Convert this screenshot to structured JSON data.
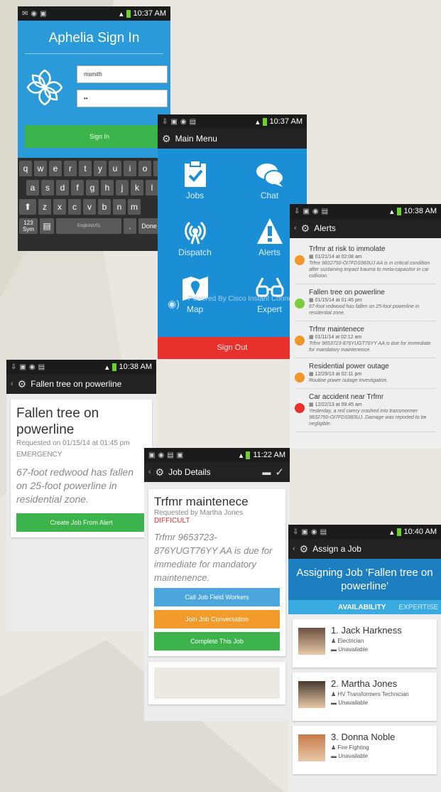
{
  "signin": {
    "time": "10:37 AM",
    "title": "Aphelia Sign In",
    "username": "msmith",
    "password": "••",
    "button": "Sign In",
    "keys_row1": [
      "q",
      "w",
      "e",
      "r",
      "t",
      "y",
      "u",
      "i",
      "o",
      "p"
    ],
    "keys_row2": [
      "a",
      "s",
      "d",
      "f",
      "g",
      "h",
      "j",
      "k",
      "l"
    ],
    "keys_row3": [
      "z",
      "x",
      "c",
      "v",
      "b",
      "n",
      "m"
    ],
    "sym": "123\nSym",
    "space": "English(US)",
    "done": "Done"
  },
  "menu": {
    "time": "10:37 AM",
    "title": "Main Menu",
    "items": [
      {
        "label": "Jobs",
        "icon": "clipboard-check-icon"
      },
      {
        "label": "Chat",
        "icon": "chat-bubbles-icon"
      },
      {
        "label": "Dispatch",
        "icon": "broadcast-icon"
      },
      {
        "label": "Alerts",
        "icon": "warning-icon"
      },
      {
        "label": "Map",
        "icon": "map-pin-icon"
      },
      {
        "label": "Expert",
        "icon": "glasses-icon"
      }
    ],
    "powered": "Powered By Cisco Instant Connect",
    "signout": "Sign Out"
  },
  "alerts": {
    "time": "10:38 AM",
    "title": "Alerts",
    "items": [
      {
        "title": "Trfmr at risk to immolate",
        "date": "01/21/14 at 02:08 am",
        "desc": "Trfmr 9832750-OI7FDS983UJ AA is in critical condition after sustaining impact trauma to meta-capacitor in car collision.",
        "color": "#f0962a"
      },
      {
        "title": "Fallen tree on powerline",
        "date": "01/15/14 at 01:45 pm",
        "desc": "67-foot redwood has fallen on 25-foot powerline in residential zone.",
        "color": "#7ccb3c"
      },
      {
        "title": "Trfmr maintenece",
        "date": "01/11/14 at 02:12 am",
        "desc": "Trfmr 9653723-876YUGT76YY AA is due for immediate for mandatory maintenence.",
        "color": "#f0962a"
      },
      {
        "title": "Residential power outage",
        "date": "12/29/13 at 02:11 pm",
        "desc": "Routine power outage investigation.",
        "color": "#f0962a"
      },
      {
        "title": "Car accident near Trfmr",
        "date": "12/22/13 at 09:45 am",
        "desc": "Yesterday, a red camry crashed into transmormer 9832750-OI7FDS983UJ. Damage was reported to be negligible.",
        "color": "#e8302d"
      }
    ]
  },
  "fallen": {
    "time": "10:38 AM",
    "title": "Fallen tree on powerline",
    "card_title": "Fallen tree on powerline",
    "requested": "Requested on 01/15/14 at 01:45 pm",
    "priority": "EMERGENCY",
    "desc": "67-foot redwood has fallen on 25-foot powerline in residential zone.",
    "button": "Create Job From Alert"
  },
  "job": {
    "time": "11:22 AM",
    "title": "Job Details",
    "card_title": "Trfmr maintenece",
    "requested": "Requested by Martha Jones",
    "difficulty": "DIFFICULT",
    "desc": "Trfmr 9653723-876YUGT76YY AA is due for immediate for mandatory maintenence.",
    "btn_call": "Call Job Field Workers",
    "btn_join": "Join Job Conversation",
    "btn_complete": "Complete This Job"
  },
  "assign": {
    "time": "10:40 AM",
    "title": "Assign a Job",
    "banner": "Assigning Job 'Fallen tree on powerline'",
    "tab_active": "AVAILABILITY",
    "tab_other": "EXPERTISE",
    "workers": [
      {
        "name": "1. Jack Harkness",
        "role": "Electrician",
        "status": "Unavailable"
      },
      {
        "name": "2. Martha Jones",
        "role": "HV Transformers Technician",
        "status": "Unavailable"
      },
      {
        "name": "3. Donna Noble",
        "role": "Fire Fighting",
        "status": "Unavailable"
      }
    ]
  },
  "colors": {
    "blue": "#2a9ad9",
    "green": "#3cb44b",
    "orange": "#f39a2c",
    "red": "#e8302d",
    "lightblue": "#4aa6dd"
  }
}
